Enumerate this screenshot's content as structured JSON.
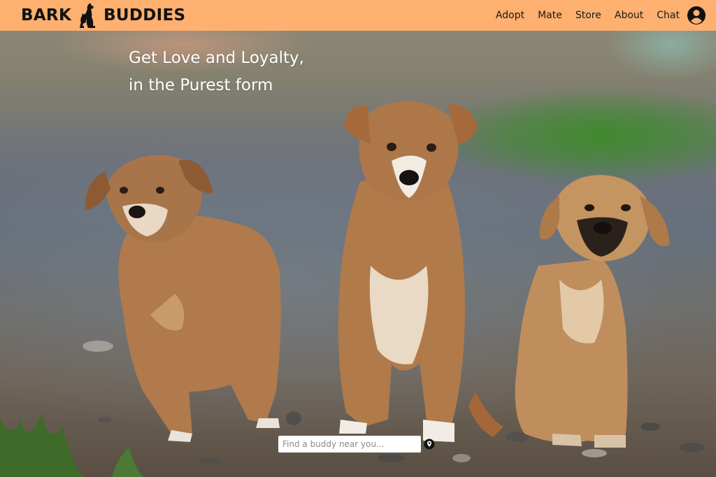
{
  "brand": {
    "name_left": "BARK",
    "name_right": "BUDDIES",
    "logo_icon": "dog-cat-silhouette-icon"
  },
  "nav": {
    "links": [
      {
        "label": "Adopt"
      },
      {
        "label": "Mate"
      },
      {
        "label": "Store"
      },
      {
        "label": "About"
      },
      {
        "label": "Chat"
      }
    ],
    "profile_icon": "account-circle-icon"
  },
  "hero": {
    "tagline_line1": "Get Love and Loyalty,",
    "tagline_line2": "in the Purest form",
    "image": "three puppies photo"
  },
  "search": {
    "placeholder": "Find a buddy near you...",
    "value": "",
    "icon": "location-pin-icon"
  },
  "colors": {
    "navbar_bg": "#fdb06f",
    "text_dark": "#111111",
    "tagline": "#ffffff"
  }
}
